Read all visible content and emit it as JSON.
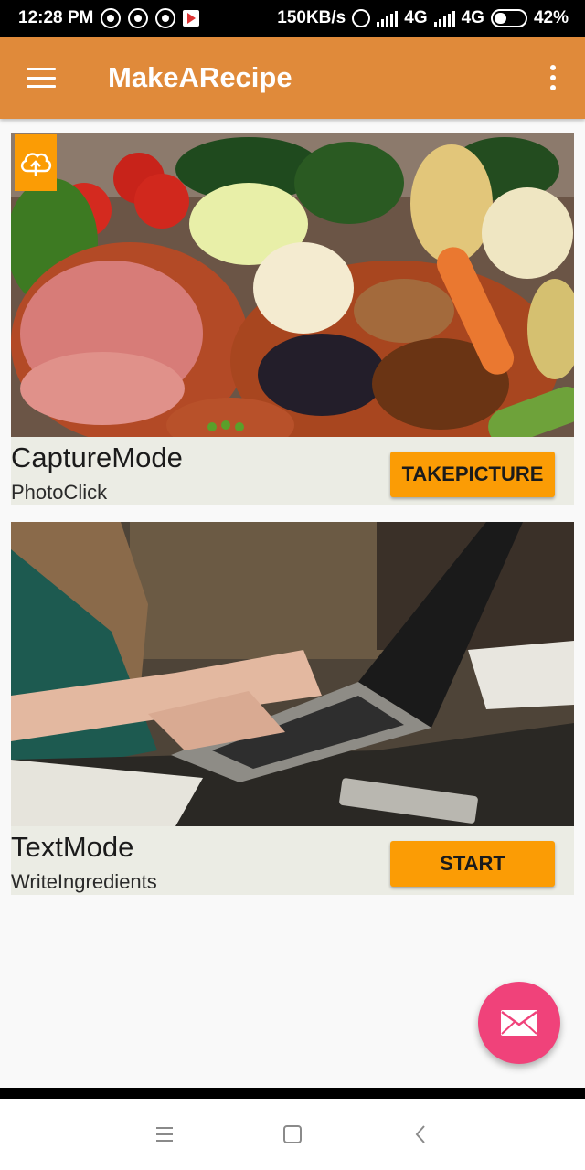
{
  "status_bar": {
    "time": "12:28 PM",
    "network_speed": "150KB/s",
    "network_1": "4G",
    "network_2": "4G",
    "battery": "42%",
    "battery_level": 0.42
  },
  "app_bar": {
    "title": "MakeARecipe",
    "menu_icon": "hamburger-menu-icon",
    "overflow_icon": "more-vert-icon",
    "color": "#e08a3a"
  },
  "cards": [
    {
      "title": "CaptureMode",
      "subtitle": "PhotoClick",
      "button_label": "TAKEPICTURE",
      "image": "vegetables-meat-nuts-photo",
      "badge_icon": "cloud-upload-icon"
    },
    {
      "title": "TextMode",
      "subtitle": "WriteIngredients",
      "button_label": "START",
      "image": "person-typing-laptop-photo"
    }
  ],
  "fab": {
    "icon": "email-icon",
    "color": "#f0427a"
  },
  "nav_bar": {
    "icons": [
      "recents-icon",
      "home-icon",
      "back-icon"
    ]
  },
  "colors": {
    "accent": "#fb9c05",
    "card_background": "#ebece4"
  }
}
